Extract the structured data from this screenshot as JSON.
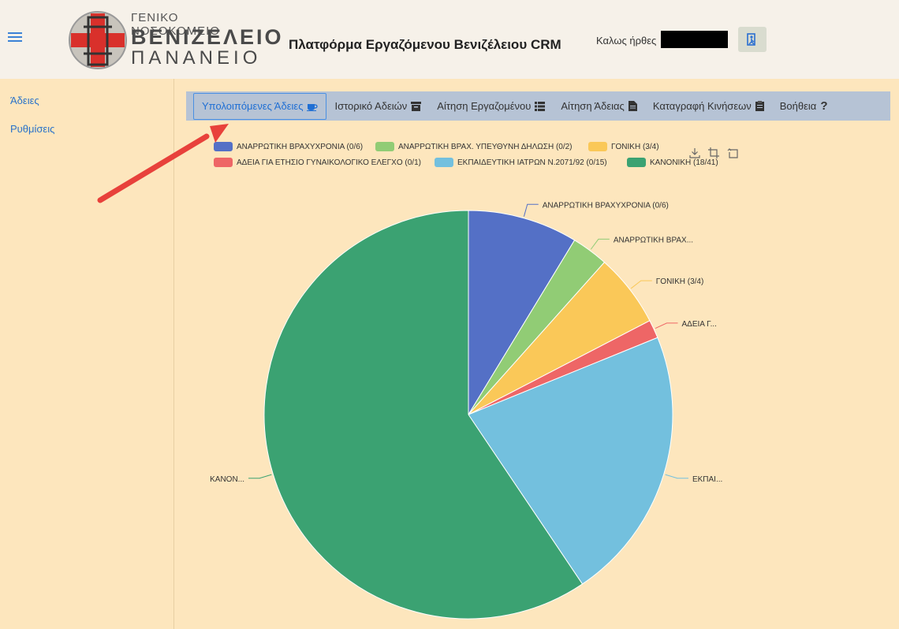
{
  "header": {
    "logo": {
      "line1": "ΓΕΝΙΚΟ ΝΟΣΟΚΟΜΕΙΟ",
      "line2": "ΒΕΝΙΖΕΛΕΙΟ",
      "line3": "ΠΑΝΑΝΕΙΟ"
    },
    "app_title": "Πλατφόρμα Εργαζόμενου Βενιζέλειου CRM",
    "welcome": "Καλως ήρθες",
    "logout_icon": "exit-icon"
  },
  "sidebar": {
    "items": [
      {
        "label": "Άδειες"
      },
      {
        "label": "Ρυθμίσεις"
      }
    ]
  },
  "tabs": [
    {
      "label": "Υπολοιπόμενες Άδειες",
      "icon": "coffee-icon",
      "active": true
    },
    {
      "label": "Ιστορικό Αδειών",
      "icon": "archive-icon"
    },
    {
      "label": "Αίτηση Εργαζομένου",
      "icon": "list-icon"
    },
    {
      "label": "Αίτηση Άδειας",
      "icon": "document-icon"
    },
    {
      "label": "Καταγραφή Κινήσεων",
      "icon": "clipboard-icon"
    },
    {
      "label": "Βοήθεια",
      "icon": "question-icon"
    }
  ],
  "chart_data": {
    "type": "pie",
    "series": [
      {
        "name": "ΑΝΑΡΡΩΤΙΚΗ ΒΡΑΧΥΧΡΟΝΙΑ (0/6)",
        "short": "ΑΝΑΡΡΩΤΙΚΗ ΒΡΑΧΥΧΡΟΝΙΑ (0/6)",
        "value": 6,
        "color": "#5470c6"
      },
      {
        "name": "ΑΝΑΡΡΩΤΙΚΗ ΒΡΑΧ. ΥΠΕΥΘΥΝΗ ΔΗΛΩΣΗ (0/2)",
        "short": "ΑΝΑΡΡΩΤΙΚΗ ΒΡΑΧ...",
        "value": 2,
        "color": "#91cc75"
      },
      {
        "name": "ΓΟΝΙΚΗ (3/4)",
        "short": "ΓΟΝΙΚΗ (3/4)",
        "value": 4,
        "color": "#fac858"
      },
      {
        "name": "ΑΔΕΙΑ ΓΙΑ ΕΤΗΣΙΟ ΓΥΝΑΙΚΟΛΟΓΙΚΟ ΕΛΕΓΧΟ (0/1)",
        "short": "ΑΔΕΙΑ Γ...",
        "value": 1,
        "color": "#ee6666"
      },
      {
        "name": "ΕΚΠΑΙΔΕΥΤΙΚΗ ΙΑΤΡΩΝ Ν.2071/92 (0/15)",
        "short": "ΕΚΠΑΙ...",
        "value": 15,
        "color": "#73c0de"
      },
      {
        "name": "ΚΑΝΟΝΙΚΗ (18/41)",
        "short": "ΚΑΝΟΝ...",
        "value": 41,
        "color": "#3ba272"
      }
    ],
    "legend_position": "top",
    "toolbox": [
      "download-icon",
      "zoom-icon",
      "restore-icon"
    ]
  }
}
